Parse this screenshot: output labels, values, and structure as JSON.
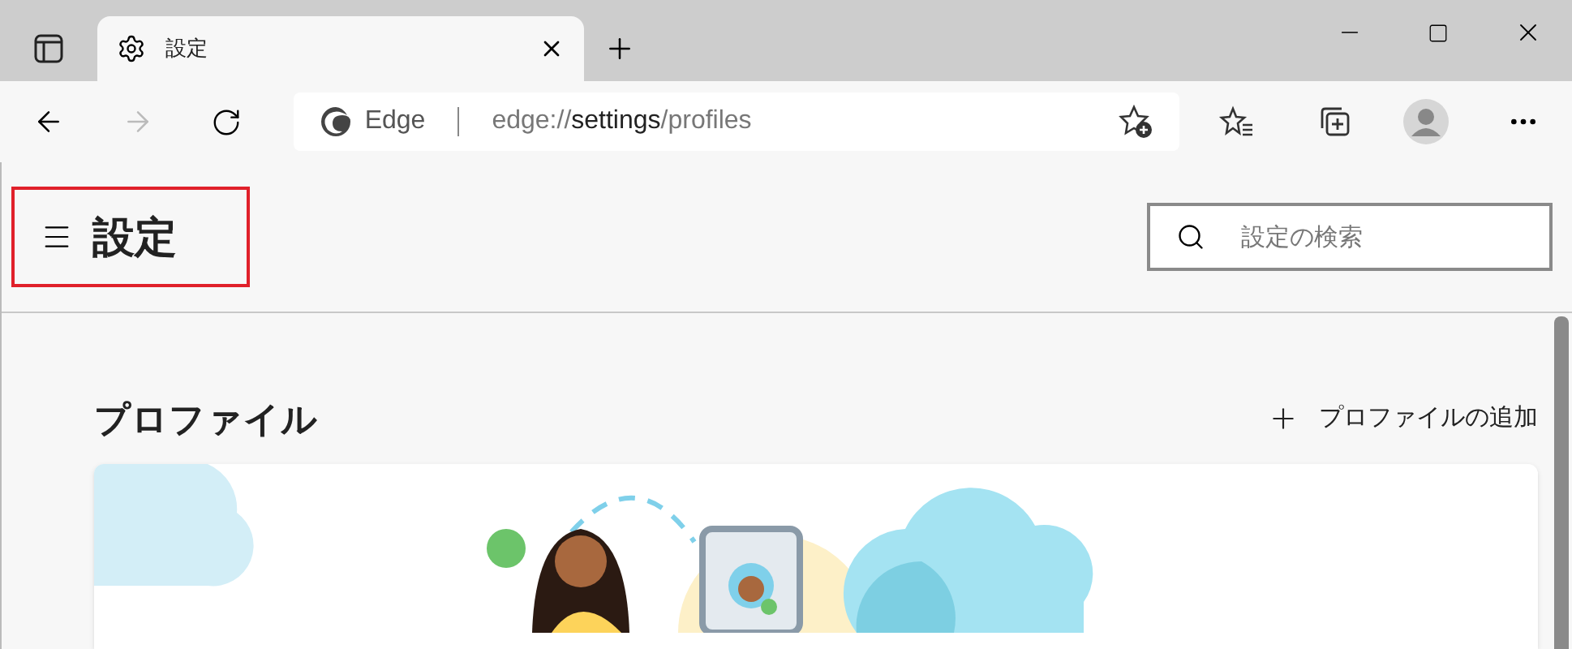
{
  "tab": {
    "title": "設定",
    "selected": true
  },
  "address": {
    "site_label": "Edge",
    "url_parts": [
      {
        "text": "edge://",
        "emphasis": false
      },
      {
        "text": "settings",
        "emphasis": true
      },
      {
        "text": "/profiles",
        "emphasis": false
      }
    ]
  },
  "header": {
    "title": "設定",
    "highlighted": true,
    "search": {
      "placeholder": "設定の検索"
    }
  },
  "section": {
    "title": "プロファイル",
    "action": "プロファイルの追加"
  }
}
